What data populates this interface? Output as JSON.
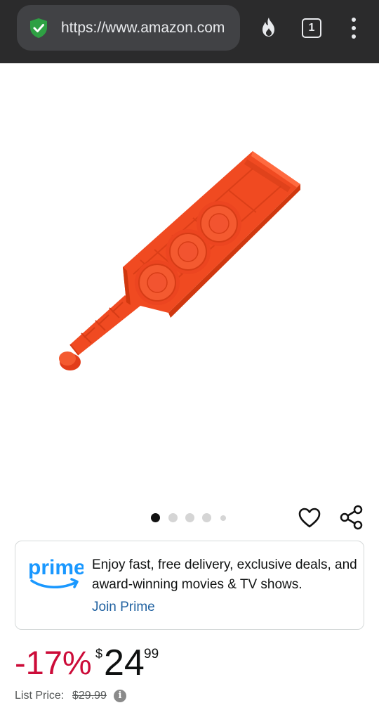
{
  "browser": {
    "url": "https://www.amazon.com",
    "tab_count": "1",
    "icons": [
      "shield-check-icon",
      "fire-icon",
      "tabs-icon",
      "more-menu-icon"
    ],
    "shield_color": "#2ea043"
  },
  "product": {
    "image_color": "#f04a21",
    "carousel": {
      "count": 5,
      "active_index": 0
    }
  },
  "actions": {
    "icons": [
      "heart-icon",
      "share-icon"
    ]
  },
  "prime": {
    "logo_text": "prime",
    "message": "Enjoy fast, free delivery, exclusive deals, and award-winning movies & TV shows.",
    "join_label": "Join Prime",
    "logo_color": "#1a98ff"
  },
  "price": {
    "discount": "-17%",
    "symbol": "$",
    "whole": "24",
    "fraction": "99",
    "list_label": "List Price:",
    "list_price": "$29.99",
    "info_glyph": "i",
    "discount_color": "#cc0c39"
  }
}
